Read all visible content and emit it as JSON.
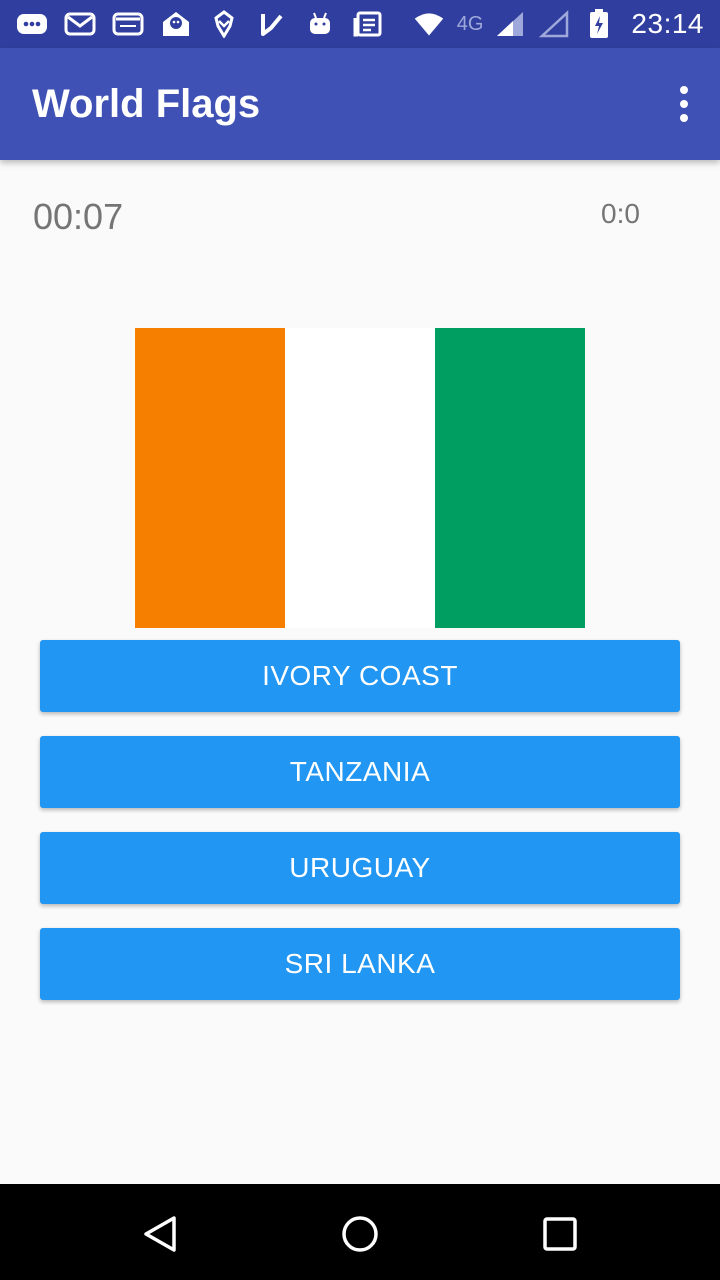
{
  "status_bar": {
    "icons": [
      "messages-icon",
      "email-icon",
      "email-icon",
      "notification-app-icon",
      "app-logo-icon",
      "check-flag-icon",
      "android-icon",
      "news-icon"
    ],
    "network_label": "4G",
    "time": "23:14"
  },
  "app_bar": {
    "title": "World Flags"
  },
  "game": {
    "timer": "00:07",
    "score": "0:0",
    "flag_colors": [
      "#f77f00",
      "#ffffff",
      "#009e60"
    ]
  },
  "answers": [
    {
      "label": "IVORY COAST"
    },
    {
      "label": "TANZANIA"
    },
    {
      "label": "URUGUAY"
    },
    {
      "label": "SRI LANKA"
    }
  ],
  "colors": {
    "status_bar": "#303f9f",
    "app_bar": "#3f51b5",
    "button": "#2196f3"
  }
}
